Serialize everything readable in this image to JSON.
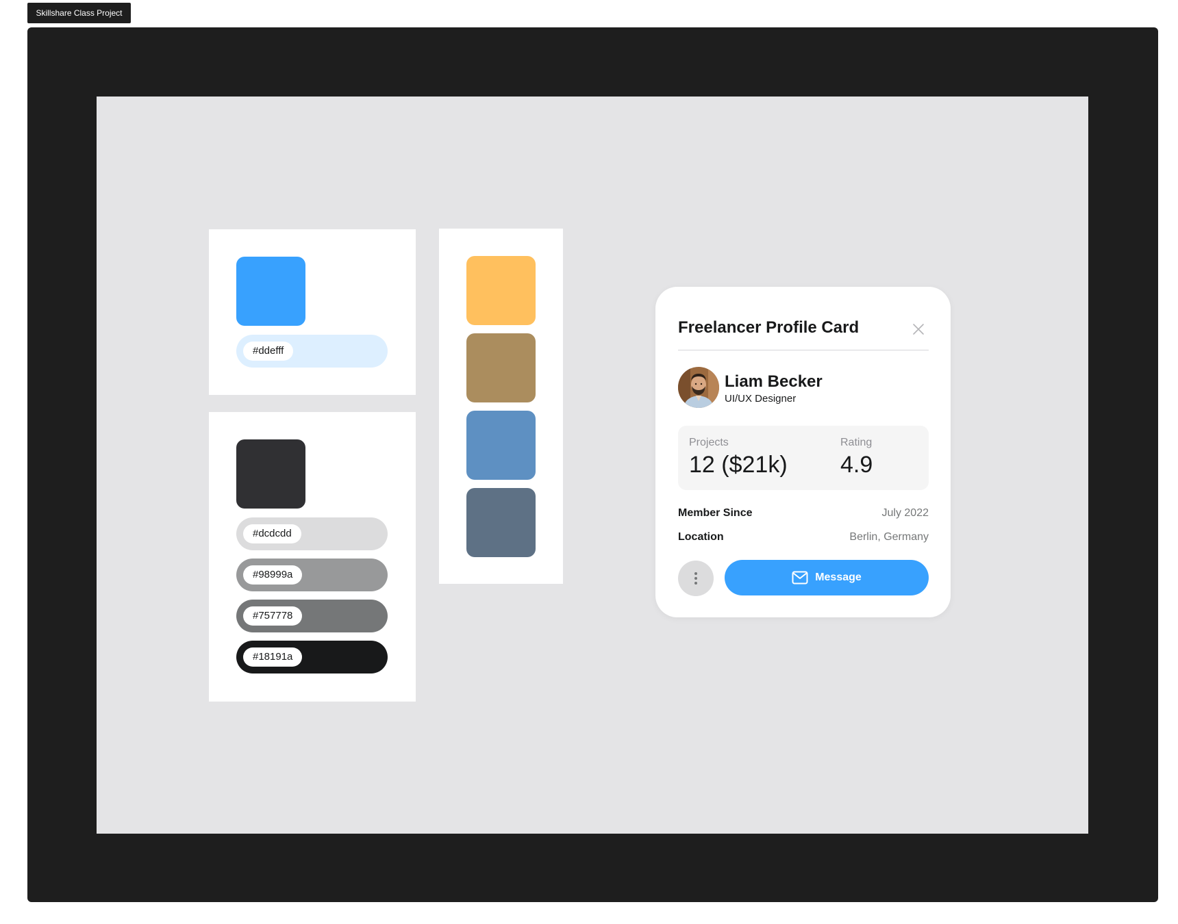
{
  "frame": {
    "label": "Skillshare Class Project"
  },
  "palette": {
    "primary": {
      "swatch_color": "#38a1fe",
      "chips": [
        {
          "label": "#ddefff",
          "color": "#ddefff"
        }
      ]
    },
    "neutral": {
      "swatch_color": "#303033",
      "chips": [
        {
          "label": "#dcdcdd",
          "color": "#dcdcdd"
        },
        {
          "label": "#98999a",
          "color": "#98999a"
        },
        {
          "label": "#757778",
          "color": "#757778"
        },
        {
          "label": "#18191a",
          "color": "#18191a"
        }
      ]
    },
    "accents": [
      "#ffc05e",
      "#ab8d5e",
      "#5e90c2",
      "#5e7185"
    ]
  },
  "card": {
    "title": "Freelancer Profile Card",
    "close_icon": "close-icon",
    "profile": {
      "name": "Liam Becker",
      "role": "UI/UX Designer"
    },
    "stats": {
      "projects_label": "Projects",
      "projects_value": "12 ($21k)",
      "rating_label": "Rating",
      "rating_value": "4.9"
    },
    "member_since_label": "Member Since",
    "member_since_value": "July 2022",
    "location_label": "Location",
    "location_value": "Berlin, Germany",
    "more_icon": "more-vertical-icon",
    "message_icon": "mail-icon",
    "message_label": "Message",
    "accent_color": "#38a1fe"
  }
}
